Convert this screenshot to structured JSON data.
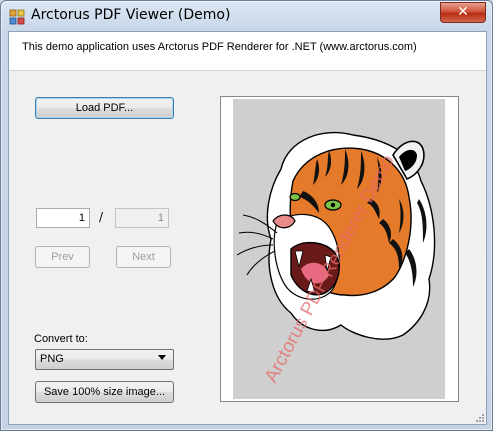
{
  "window": {
    "title": "Arctorus PDF Viewer (Demo)",
    "close_glyph": "✕"
  },
  "header": {
    "text": "This demo application uses Arctorus PDF Renderer for .NET (www.arctorus.com)"
  },
  "controls": {
    "load_label": "Load PDF...",
    "page_current": "1",
    "page_separator": "/",
    "page_total": "1",
    "prev_label": "Prev",
    "next_label": "Next",
    "convert_label": "Convert to:",
    "format_selected": "PNG",
    "save_label": "Save 100% size image..."
  },
  "preview": {
    "watermark": "Arctorus PDF Renderer Demo",
    "watermark_color": "#e86a6a",
    "page_background": "#cfcfcf",
    "image_subject": "tiger-head-illustration"
  }
}
